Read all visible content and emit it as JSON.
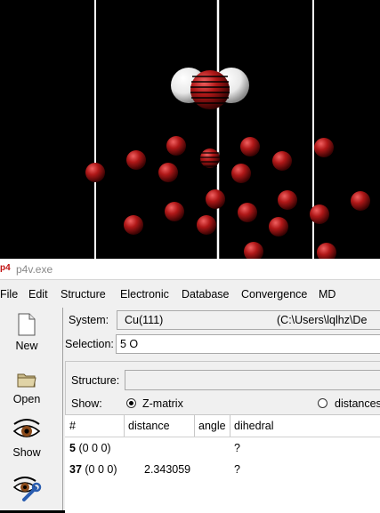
{
  "window": {
    "title": "p4v.exe",
    "app_icon_text": "p4"
  },
  "menu": [
    "File",
    "Edit",
    "Structure",
    "Electronic",
    "Database",
    "Convergence",
    "MD"
  ],
  "toolbar": [
    {
      "label": "New",
      "icon": "document-icon"
    },
    {
      "label": "Open",
      "icon": "folder-icon"
    },
    {
      "label": "Show",
      "icon": "eye-icon"
    },
    {
      "label": "",
      "icon": "eye-wrench-icon"
    }
  ],
  "system": {
    "label": "System:",
    "value": "Cu(111)",
    "path": "(C:\\Users\\lqlhz\\De"
  },
  "selection": {
    "label": "Selection:",
    "value": "5 O"
  },
  "structure": {
    "label": "Structure:",
    "value": ""
  },
  "show": {
    "label": "Show:",
    "options": [
      {
        "label": "Z-matrix",
        "selected": true
      },
      {
        "label": "distances",
        "selected": false
      }
    ]
  },
  "table": {
    "headers": [
      "#",
      "distance",
      "angle",
      "dihedral"
    ],
    "rows": [
      {
        "index": "5",
        "cell": "(0 0 0)",
        "distance": "",
        "angle": "",
        "dihedral": "?"
      },
      {
        "index": "37",
        "cell": "(0 0 0)",
        "distance": "2.343059",
        "angle": "",
        "dihedral": "?"
      }
    ]
  },
  "colors": {
    "viewport_bg": "#000000",
    "copper_atom": "#b01818",
    "hydrogen_atom": "#ffffff",
    "window_bg": "#f0f0f0"
  }
}
